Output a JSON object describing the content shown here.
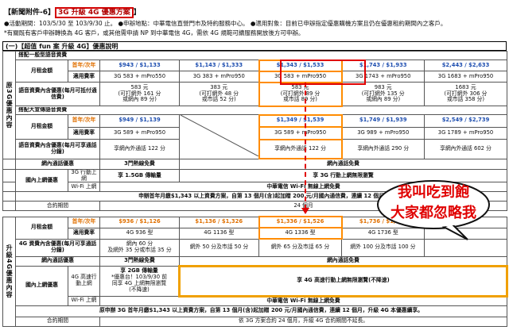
{
  "header": {
    "title_prefix": "【新聞附件-6】",
    "title_highlight": "3G 升級 4G 優惠方案",
    "title_suffix": "】",
    "line1": "●活動期間：103/5/30 至 103/9/30 止。 ●申辦地點：中華電信直營門市及特約服務中心。 ●適用對象：目前已申辦指定優惠購機方案且仍在優惠租約期間內之客戶。",
    "line2": "*有關既有客戶申辦轉換為 4G 客戶，或其他需申請 NP 到中華電信 4G，需依 4G 規範可續服務開放後方可申辦。"
  },
  "section1": {
    "title": "(一)【超值 fun 案 升級 4G】優惠說明"
  },
  "table_a": {
    "side_label": "原3G優惠內容",
    "sub1_label": "搭配一般型語音資費",
    "row_month_label": "月租金額",
    "col_year_label": "首年/次年",
    "applicable_label": "適用費率",
    "prices": [
      "$943 / $1,133",
      "$1,143 / $1,333",
      "$1,343 / $1,533",
      "$1,743 / $1,933",
      "$2,443 / $2,633"
    ],
    "rates": [
      "3G 583 + mPro550",
      "3G 383 + mPro950",
      "3G 583 + mPro950",
      "3G 1743 + mPro950",
      "3G 1683 + mPro950"
    ],
    "voice_label": "語音資費內含優惠(每月可抵付通信費)",
    "voice": [
      [
        "583 元",
        "(可打網外 161 分",
        "或網內 89 分)"
      ],
      [
        "383 元",
        "(可打網外 48 分",
        "或市話 52 分)"
      ],
      [
        "583 元",
        "(可打網外 89 分",
        "或市話 89 分)"
      ],
      [
        "983 元",
        "(可打網外 135 分",
        "或網內 89 分)"
      ],
      [
        "1683 元",
        "(可打網外 306 分",
        "或市話 358 分)"
      ]
    ],
    "sub2_label": "搭配大宣傳語音資費",
    "sub2_prices": [
      "$949 / $1,139",
      "$1,349 / $1,539",
      "$1,749 / $1,939",
      "$2,549 / $2,739"
    ],
    "sub2_rates": [
      "3G 589 + mPro950",
      "3G 589 + mPro950",
      "3G 989 + mPro950",
      "3G 1789 + mPro950"
    ],
    "voice2_label": "語音資費內含優惠(每月可享通話分鐘)",
    "voice2": [
      "享網內外通話 122 分",
      "享網內外通話 122 分",
      "享網內外通話 290 分",
      "享網內外通話 602 分"
    ],
    "intranet_label": "網內通話優惠",
    "intranet_value": "3門熱線免費",
    "intranet_value2": "網內通話免費",
    "domestic_label": "國內上網優惠",
    "g3_label": "3G 行動上網",
    "g3_value": "享 1.5GB 傳輸量",
    "g3_value2": "享 3G 行動上網無限瀏覽",
    "wifi_label": "Wi-Fi 上網",
    "wifi_value": "中華電信 Wi-Fi 無線上網免費",
    "footer": "申辦首年月繳$1,343 以上資費方案，自第 13 個月(含)起加贈 200 元/月國內通信費，連續 12 個月",
    "contract_label": "合約期間",
    "contract_value": "24 個月"
  },
  "table_b": {
    "side_label": "升級4G優惠內容",
    "row_month_label": "月租金額",
    "col_year_label": "首年/次年",
    "applicable_label": "適用費率",
    "prices": [
      "$936 / $1,126",
      "$1,136 / $1,326",
      "$1,336 / $1,526",
      "$1,736 / $1,926"
    ],
    "rates": [
      "4G 936 型",
      "4G 1136 型",
      "4G 1336 型",
      "4G 1736 型"
    ],
    "voice_label": "4G 資費內含優惠(每月可享通話分鐘)",
    "voice": [
      [
        "網內 60 分",
        "及網外 35 分或市話 35 分"
      ],
      [
        "網外 50 分及市話 50 分"
      ],
      [
        "網外 65 分及市話 65 分"
      ],
      [
        "網外 100 分及市話 100 分"
      ]
    ],
    "intranet_label": "網內通話優惠",
    "intranet_value": "3門熱線免費",
    "intranet_value2": "網內通話免費",
    "domestic_label": "國內上網優惠",
    "g4_label": "4G 高速行動上網",
    "g4_value": [
      "享 2GB 傳輸量",
      "*優惠台！103/9/30 前",
      "同享 4G 上網無限瀏覽",
      "(不降速)"
    ],
    "g4_value2": "享 4G 高速行動上網無限瀏覽(不降速)",
    "wifi_label": "Wi-Fi 上網",
    "wifi_value": "中華電信 Wi-Fi 無線上網免費",
    "footer": "原申辦 3G 首年月繳$1,343 以上資費方案，自第 13 個月(含)起加贈 200 元/月國內通信費，連續 12 個月，升級 4G 本優惠續享。",
    "contract_label": "合約期間",
    "contract_value": "依 3G 方案合約 24 個月，升級 4G 合約期間不延長。"
  },
  "annotation": {
    "line1": "我叫吃到飽",
    "line2": "大家都忽略我"
  }
}
